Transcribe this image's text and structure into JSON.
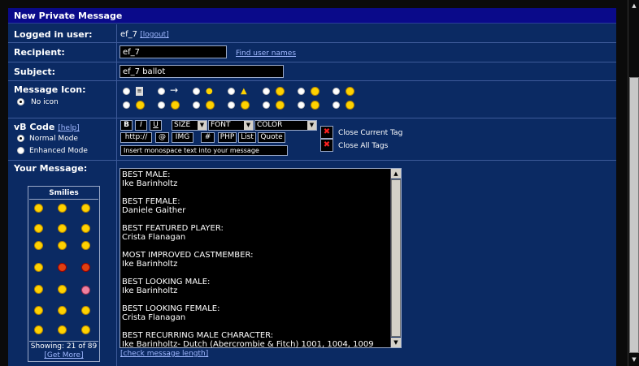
{
  "title": "New Private Message",
  "logged_in": {
    "label": "Logged in user:",
    "username": "ef_7",
    "logout": "[logout]"
  },
  "recipient": {
    "label": "Recipient:",
    "value": "ef_7",
    "find_link": "Find user names"
  },
  "subject": {
    "label": "Subject:",
    "value": "ef_7 ballot"
  },
  "message_icon": {
    "label": "Message Icon:",
    "no_icon": "No icon"
  },
  "vbcode": {
    "label": "vB Code",
    "help": "[help]",
    "normal_mode": "Normal Mode",
    "enhanced_mode": "Enhanced Mode",
    "btn_bold": "B",
    "btn_italic": "I",
    "btn_underline": "U",
    "size": "SIZE",
    "font": "FONT",
    "color": "COLOR",
    "btn_http": "http://",
    "btn_email": "@",
    "btn_img": "IMG",
    "btn_code": "#",
    "btn_php": "PHP",
    "btn_list": "List",
    "btn_quote": "Quote",
    "close_current": "Close Current Tag",
    "close_all": "Close All Tags",
    "status_text": "Insert monospace text into your message"
  },
  "your_message": {
    "label": "Your Message:",
    "text": "BEST MALE:\nIke Barinholtz\n\nBEST FEMALE:\nDaniele Gaither\n\nBEST FEATURED PLAYER:\nCrista Flanagan\n\nMOST IMPROVED CASTMEMBER:\nIke Barinholtz\n\nBEST LOOKING MALE:\nIke Barinholtz\n\nBEST LOOKING FEMALE:\nCrista Flanagan\n\nBEST RECURRING MALE CHARACTER:\nIke Barinholtz- Dutch (Abercrombie & Fitch) 1001, 1004, 1009",
    "check_length": "[check message length]"
  },
  "smilies": {
    "header": "Smilies",
    "showing": "Showing: 21 of 89",
    "get_more": "[Get More]"
  },
  "icons": {
    "row1": [
      "page-icon",
      "arrow-icon",
      "lightbulb-icon",
      "warning-icon",
      "question-icon",
      "cool-icon",
      "smile-icon"
    ],
    "row2": [
      "angry-icon",
      "frown-icon",
      "laugh-icon",
      "redface-icon",
      "happy-icon",
      "thumbs-down-icon",
      "thumbs-up-icon"
    ]
  },
  "colors": {
    "panel": "#0b2a63",
    "title_bar": "#0a0a8a",
    "link": "#9fb7ff"
  }
}
